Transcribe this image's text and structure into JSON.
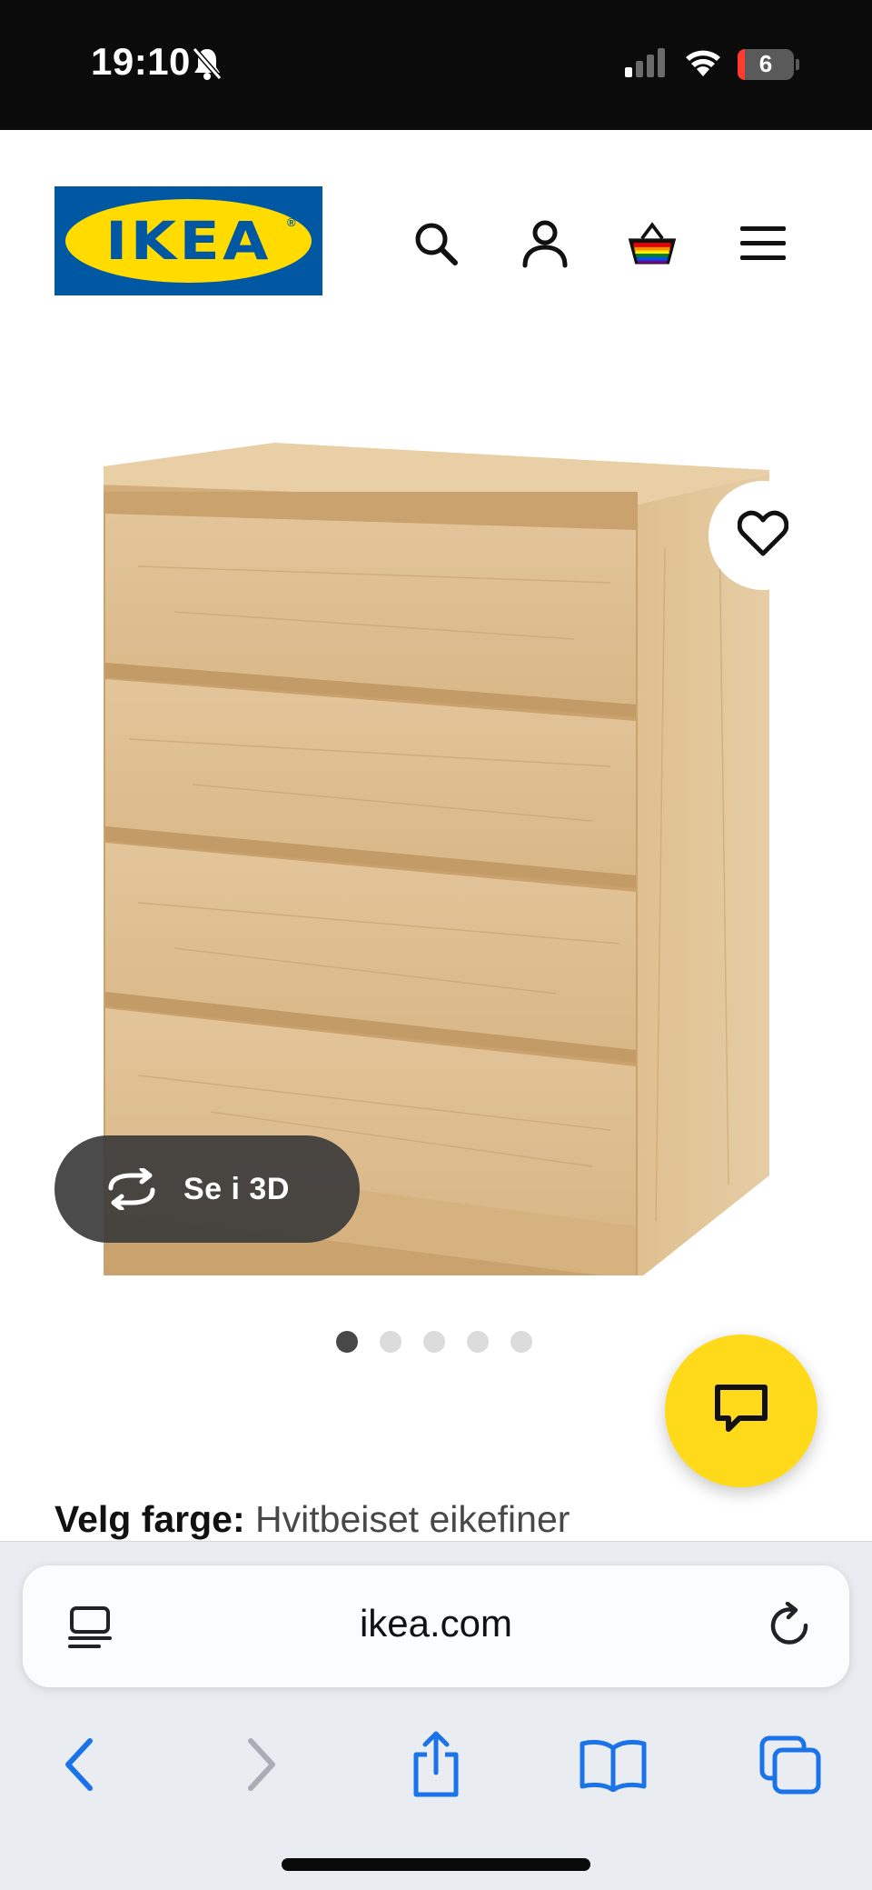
{
  "status_bar": {
    "time": "19:10",
    "battery": "6"
  },
  "header": {
    "logo_text": "IKEA",
    "logo_reg": "®"
  },
  "product": {
    "view_3d_label": "Se i 3D",
    "image_dots": 5,
    "active_dot": 0
  },
  "color_choice": {
    "label": "Velg farge:",
    "value": "Hvitbeiset eikefiner"
  },
  "browser": {
    "url": "ikea.com"
  },
  "colors": {
    "ikea_blue": "#0058a3",
    "ikea_yellow": "#ffdb00",
    "chat_yellow": "#ffda1a",
    "safari_blue": "#1a73e8"
  },
  "icons": [
    "bell-slash-icon",
    "signal-icon",
    "wifi-icon",
    "battery-icon",
    "search-icon",
    "account-icon",
    "basket-icon",
    "menu-icon",
    "heart-icon",
    "rotate-3d-icon",
    "chat-icon",
    "tab-overview-icon",
    "reload-icon",
    "back-icon",
    "forward-icon",
    "share-icon",
    "bookmarks-icon",
    "tabs-icon"
  ]
}
